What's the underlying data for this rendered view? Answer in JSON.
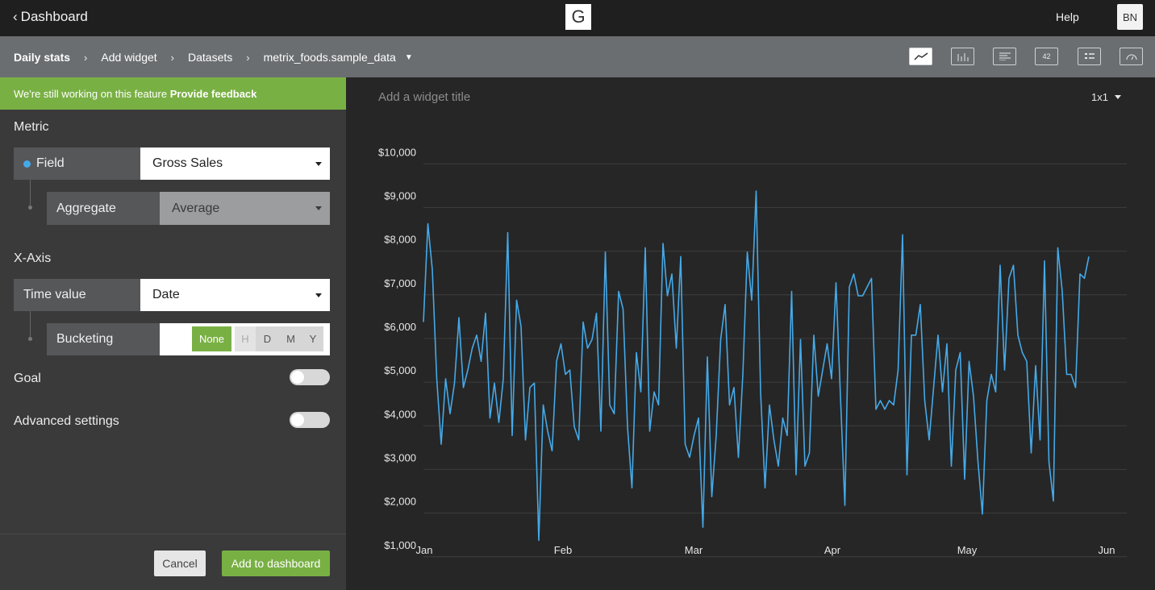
{
  "topbar": {
    "back_label": "Dashboard",
    "logo_letter": "G",
    "help_label": "Help",
    "avatar_initials": "BN"
  },
  "breadcrumb": {
    "items": [
      "Daily stats",
      "Add widget",
      "Datasets",
      "metrix_foods.sample_data"
    ]
  },
  "widget_types": [
    {
      "icon": "line-chart-icon",
      "label": ""
    },
    {
      "icon": "bar-chart-icon",
      "label": ""
    },
    {
      "icon": "text-icon",
      "label": ""
    },
    {
      "icon": "number-icon",
      "label": "42"
    },
    {
      "icon": "list-icon",
      "label": ""
    },
    {
      "icon": "gauge-icon",
      "label": ""
    }
  ],
  "banner": {
    "text": "We're still working on this feature",
    "link": "Provide feedback"
  },
  "metric": {
    "heading": "Metric",
    "field_label": "Field",
    "field_value": "Gross Sales",
    "aggregate_label": "Aggregate",
    "aggregate_value": "Average"
  },
  "xaxis": {
    "heading": "X-Axis",
    "time_label": "Time value",
    "time_value": "Date",
    "bucketing_label": "Bucketing",
    "bucketing_options": [
      "None",
      "H",
      "D",
      "M",
      "Y"
    ],
    "bucketing_selected": "None"
  },
  "goal": {
    "label": "Goal",
    "enabled": false
  },
  "advanced": {
    "label": "Advanced settings",
    "enabled": false
  },
  "footer": {
    "cancel_label": "Cancel",
    "add_label": "Add to dashboard"
  },
  "widget": {
    "title_placeholder": "Add a widget title",
    "size": "1x1"
  },
  "colors": {
    "accent": "#79b044",
    "line": "#45a9e8"
  },
  "chart_data": {
    "type": "line",
    "title": "",
    "xlabel": "",
    "ylabel": "",
    "x_ticks": [
      "Jan",
      "Feb",
      "Mar",
      "Apr",
      "May",
      "Jun"
    ],
    "x_range": [
      "Jan 1",
      "May 28"
    ],
    "y_ticks": [
      "$1,000",
      "$2,000",
      "$3,000",
      "$4,000",
      "$5,000",
      "$6,000",
      "$7,000",
      "$8,000",
      "$9,000",
      "$10,000"
    ],
    "ylim": [
      700,
      10300
    ],
    "grid": true,
    "series": [
      {
        "values": [
          6100,
          8350,
          7300,
          4800,
          3300,
          4800,
          4000,
          4700,
          6200,
          4600,
          5000,
          5500,
          5800,
          5200,
          6300,
          3900,
          4700,
          3800,
          4800,
          8150,
          3500,
          6600,
          6000,
          3400,
          4600,
          4700,
          1100,
          4200,
          3600,
          3150,
          5200,
          5600,
          4900,
          5000,
          3700,
          3400,
          6100,
          5500,
          5700,
          6300,
          3600,
          7700,
          4200,
          4000,
          6800,
          6400,
          3700,
          2300,
          5400,
          4500,
          7800,
          3600,
          4500,
          4200,
          7900,
          6700,
          7200,
          5500,
          7600,
          3300,
          3000,
          3500,
          3900,
          1400,
          5300,
          2100,
          3500,
          5700,
          6500,
          4200,
          4600,
          3000,
          4900,
          7700,
          6600,
          9100,
          4500,
          2300,
          4200,
          3400,
          2800,
          3900,
          3500,
          6800,
          2600,
          5700,
          2800,
          3100,
          5800,
          4400,
          5000,
          5600,
          4800,
          7000,
          4400,
          1900,
          6900,
          7200,
          6700,
          6700,
          6900,
          7100,
          4100,
          4300,
          4100,
          4300,
          4200,
          5000,
          8100,
          2600,
          5800,
          5800,
          6500,
          4300,
          3400,
          4600,
          5800,
          4500,
          5600,
          2800,
          5000,
          5400,
          2500,
          5200,
          4400,
          2900,
          1700,
          4300,
          4900,
          4500,
          7400,
          5000,
          7100,
          7400,
          5800,
          5400,
          5200,
          3100,
          5100,
          3400,
          7500,
          2900,
          2000,
          7800,
          6800,
          4900,
          4900,
          4600,
          7200,
          7100,
          7600
        ]
      }
    ]
  }
}
